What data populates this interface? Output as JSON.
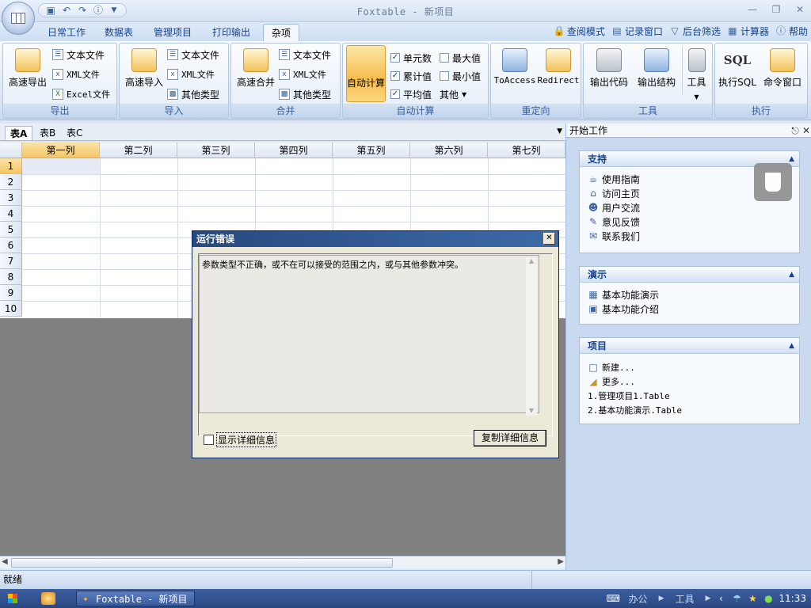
{
  "window": {
    "title": "Foxtable - 新项目",
    "icons": [
      "minimize-icon",
      "restore-icon",
      "close-icon"
    ]
  },
  "tabs": [
    "日常工作",
    "数据表",
    "管理项目",
    "打印输出",
    "杂项"
  ],
  "right_tools": [
    {
      "label": "查阅模式",
      "icon": "lock-icon"
    },
    {
      "label": "记录窗口",
      "icon": "window-icon"
    },
    {
      "label": "后台筛选",
      "icon": "filter-icon"
    },
    {
      "label": "计算器",
      "icon": "calculator-icon"
    },
    {
      "label": "帮助",
      "icon": "help-icon"
    }
  ],
  "ribbon": {
    "export": {
      "label": "导出",
      "big": "高速导出",
      "items": [
        "文本文件",
        "XML文件",
        "Excel文件"
      ]
    },
    "import": {
      "label": "导入",
      "big": "高速导入",
      "items": [
        "文本文件",
        "XML文件",
        "其他类型"
      ]
    },
    "merge": {
      "label": "合并",
      "big": "高速合并",
      "items": [
        "文本文件",
        "XML文件",
        "其他类型"
      ]
    },
    "autocalc": {
      "label": "自动计算",
      "big": "自动计算",
      "checks": [
        "单元数",
        "累计值",
        "平均值"
      ],
      "checks2": [
        "最大值",
        "最小值"
      ],
      "other": "其他"
    },
    "redirect": {
      "label": "重定向",
      "items": [
        "ToAccess",
        "Redirect"
      ]
    },
    "tools": {
      "label": "工具",
      "items": [
        "输出代码",
        "输出结构",
        "工具"
      ]
    },
    "execute": {
      "label": "执行",
      "items": [
        "执行SQL",
        "命令窗口"
      ],
      "sql": "SQL"
    }
  },
  "sheet_tabs": [
    "表A",
    "表B",
    "表C"
  ],
  "grid": {
    "columns": [
      "第一列",
      "第二列",
      "第三列",
      "第四列",
      "第五列",
      "第六列",
      "第七列"
    ],
    "rows": [
      "1",
      "2",
      "3",
      "4",
      "5",
      "6",
      "7",
      "8",
      "9",
      "10"
    ]
  },
  "pane": {
    "title": "开始工作",
    "support": {
      "title": "支持",
      "items": [
        "使用指南",
        "访问主页",
        "用户交流",
        "意见反馈",
        "联系我们"
      ]
    },
    "demo": {
      "title": "演示",
      "items": [
        "基本功能演示",
        "基本功能介绍"
      ]
    },
    "project": {
      "title": "项目",
      "items": [
        "新建...",
        "更多...",
        "1.管理项目1.Table",
        "2.基本功能演示.Table"
      ]
    }
  },
  "dialog": {
    "title": "运行错误",
    "message": "参数类型不正确，或不在可以接受的范围之内，或与其他参数冲突。",
    "show_detail": "显示详细信息",
    "copy_button": "复制详细信息"
  },
  "status": {
    "text": "就绪"
  },
  "taskbar": {
    "app": "Foxtable - 新项目",
    "tray_items": [
      "办公",
      "工具"
    ],
    "time": "11:33"
  }
}
